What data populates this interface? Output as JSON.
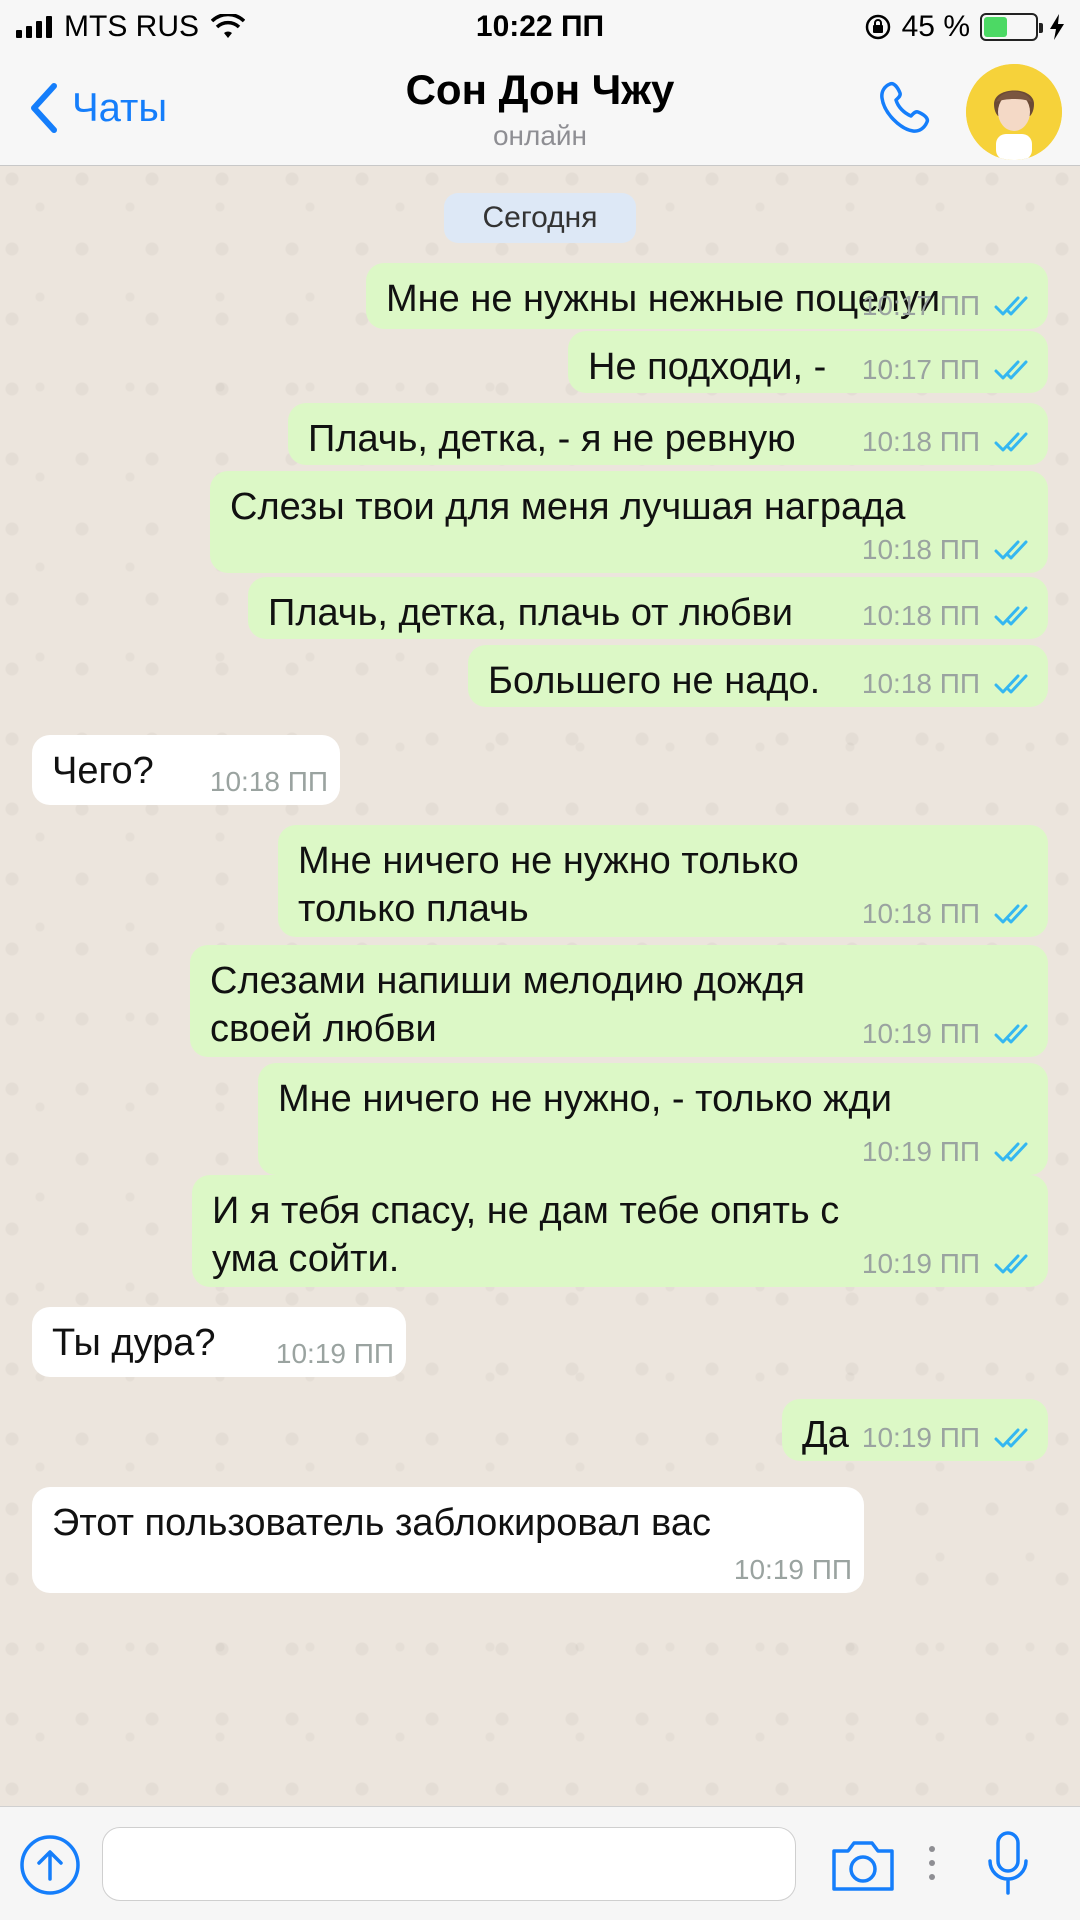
{
  "status_bar": {
    "carrier": "MTS RUS",
    "time": "10:22 ПП",
    "battery_text": "45 %",
    "battery_level": 0.45,
    "battery_color": "#4cd964"
  },
  "nav": {
    "back_label": "Чаты",
    "contact_name": "Сон Дон Чжу",
    "contact_status": "онлайн",
    "accent_color": "#157efb",
    "icons": [
      "chevron-left-icon",
      "phone-icon",
      "avatar"
    ]
  },
  "chat": {
    "date_label": "Сегодня",
    "messages": [
      {
        "dir": "out",
        "text": "Мне не нужны нежные поцелуи",
        "time": "10:17 ПП",
        "read": true
      },
      {
        "dir": "out",
        "text": "Не подходи, -",
        "time": "10:17 ПП",
        "read": true
      },
      {
        "dir": "out",
        "text": "Плачь, детка, - я не ревную",
        "time": "10:18 ПП",
        "read": true
      },
      {
        "dir": "out",
        "text": "Слезы твои для меня лучшая награда",
        "time": "10:18 ПП",
        "read": true
      },
      {
        "dir": "out",
        "text": "Плачь, детка, плачь от любви",
        "time": "10:18 ПП",
        "read": true
      },
      {
        "dir": "out",
        "text": "Большего не надо.",
        "time": "10:18 ПП",
        "read": true
      },
      {
        "dir": "in",
        "text": "Чего?",
        "time": "10:18 ПП"
      },
      {
        "dir": "out",
        "text": "Мне ничего не нужно только\nтолько плачь",
        "time": "10:18 ПП",
        "read": true
      },
      {
        "dir": "out",
        "text": "Слезами напиши мелодию дождя\nсвоей любви",
        "time": "10:19 ПП",
        "read": true
      },
      {
        "dir": "out",
        "text": "Мне ничего не нужно, - только жди",
        "time": "10:19 ПП",
        "read": true
      },
      {
        "dir": "out",
        "text": "И я тебя спасу, не дам тебе опять с\nума сойти.",
        "time": "10:19 ПП",
        "read": true
      },
      {
        "dir": "in",
        "text": "Ты дура?",
        "time": "10:19 ПП"
      },
      {
        "dir": "out",
        "text": "Да",
        "time": "10:19 ПП",
        "read": true
      },
      {
        "dir": "in",
        "text": "Этот пользователь заблокировал вас",
        "time": "10:19 ПП"
      }
    ],
    "outgoing_color": "#dcf8c6",
    "incoming_color": "#ffffff",
    "read_tick_color": "#34b7f1"
  },
  "input_bar": {
    "message_value": "",
    "icons": [
      "upload-icon",
      "camera-icon",
      "mic-icon"
    ]
  }
}
